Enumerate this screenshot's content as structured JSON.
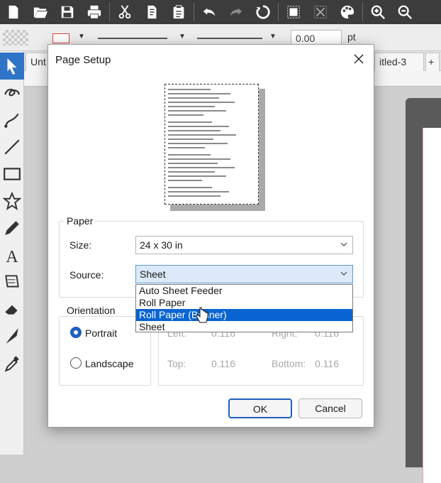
{
  "toolbar": {
    "buttons": [
      "new-icon",
      "open-icon",
      "save-icon",
      "print-icon",
      "cut-icon",
      "copy-icon",
      "paste-icon",
      "undo-icon",
      "redo-icon",
      "refresh-icon",
      "group-icon",
      "ungroup-icon",
      "palette-icon",
      "zoom-in-icon",
      "zoom-out-icon"
    ]
  },
  "propbar": {
    "line_width_value": "0.00",
    "unit": "pt"
  },
  "tabs": {
    "left_tab": "Unt",
    "right_tab": "itled-3",
    "add_tab": "+"
  },
  "dialog": {
    "title": "Page Setup",
    "paper_group": "Paper",
    "size_label": "Size:",
    "size_value": "24 x 30 in",
    "source_label": "Source:",
    "source_value": "Sheet",
    "source_options": [
      "Auto Sheet Feeder",
      "Roll Paper",
      "Roll Paper (Banner)",
      "Sheet"
    ],
    "source_highlighted": "Roll Paper (Banner)",
    "orientation_group": "Orientation",
    "portrait_label": "Portrait",
    "landscape_label": "Landscape",
    "orientation_selected": "Portrait",
    "margins": {
      "left_label": "Left:",
      "left_value": "0.116",
      "right_label": "Right:",
      "right_value": "0.116",
      "top_label": "Top:",
      "top_value": "0.116",
      "bottom_label": "Bottom:",
      "bottom_value": "0.116"
    },
    "ok_label": "OK",
    "cancel_label": "Cancel"
  },
  "colors": {
    "accent": "#0a64d1",
    "toolbar_bg": "#3c3c3c",
    "active_tool": "#2f74c7"
  }
}
